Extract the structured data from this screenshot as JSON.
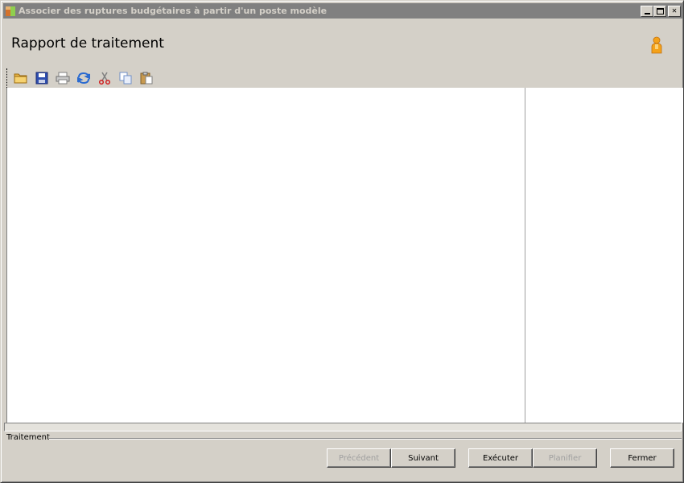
{
  "window": {
    "title": "Associer des ruptures budgétaires à partir d'un poste modèle",
    "minimize_icon": "minimize-icon",
    "maximize_icon": "maximize-icon",
    "close_label": "✕"
  },
  "header": {
    "title": "Rapport de traitement",
    "user_icon": "user-icon"
  },
  "toolbar": {
    "items": [
      "open-folder-icon",
      "save-icon",
      "print-icon",
      "refresh-icon",
      "cut-icon",
      "copy-icon",
      "paste-icon"
    ]
  },
  "group": {
    "label": "Traitement"
  },
  "buttons": {
    "previous": "Précédent",
    "next": "Suivant",
    "execute": "Exécuter",
    "schedule": "Planifier",
    "close": "Fermer"
  },
  "colors": {
    "titlebar": "#808080",
    "window_bg": "#d4d0c8",
    "content_bg": "#ffffff"
  }
}
